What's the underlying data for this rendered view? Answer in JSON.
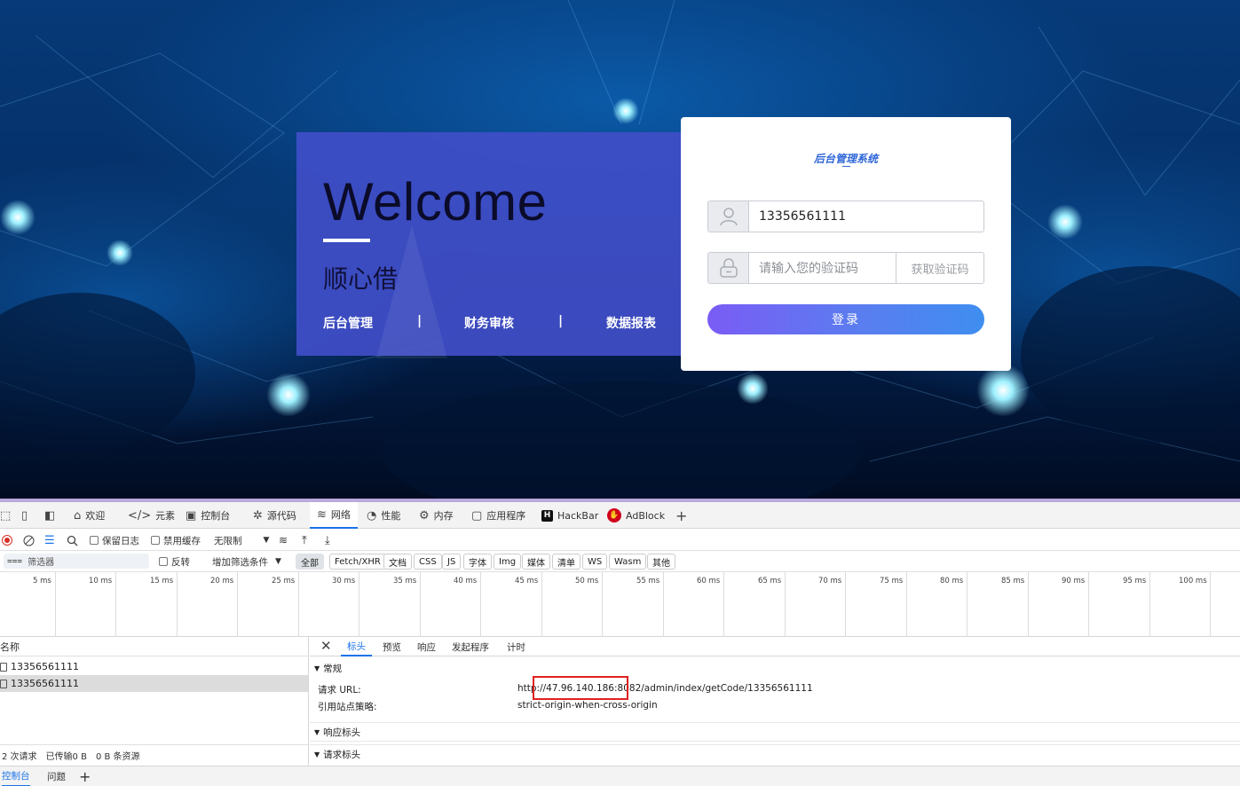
{
  "welcome": {
    "title": "Welcome",
    "subtitle": "顺心借",
    "nav": [
      "后台管理",
      "|",
      "财务审核",
      "|",
      "数据报表"
    ]
  },
  "login": {
    "title": "后台管理系统",
    "phone_value": "13356561111",
    "code_placeholder": "请输入您的验证码",
    "get_code_label": "获取验证码",
    "submit_label": "登录",
    "user_icon": "user-icon",
    "lock_icon": "lock-icon",
    "accent_color": "#5a7df0"
  },
  "devtools": {
    "tabs": [
      {
        "icon": "home-icon",
        "label": "欢迎"
      },
      {
        "icon": "code-icon",
        "label": "元素"
      },
      {
        "icon": "console-icon",
        "label": "控制台"
      },
      {
        "icon": "bug-icon",
        "label": "源代码"
      },
      {
        "icon": "wifi-icon",
        "label": "网络"
      },
      {
        "icon": "performance-icon",
        "label": "性能"
      },
      {
        "icon": "memory-icon",
        "label": "内存"
      },
      {
        "icon": "application-icon",
        "label": "应用程序"
      },
      {
        "icon": "hackbar-icon",
        "label": "HackBar"
      },
      {
        "icon": "adblock-icon",
        "label": "AdBlock"
      }
    ],
    "toolbar": {
      "preserve_log": "保留日志",
      "disable_cache": "禁用缓存",
      "throttle": "无限制"
    },
    "filter": {
      "placeholder": "筛选器",
      "invert": "反转",
      "more_filters": "增加筛选条件",
      "chips": [
        "全部",
        "Fetch/XHR",
        "文档",
        "CSS",
        "JS",
        "字体",
        "Img",
        "媒体",
        "清单",
        "WS",
        "Wasm",
        "其他"
      ]
    },
    "timeline_ticks": [
      "5 ms",
      "10 ms",
      "15 ms",
      "20 ms",
      "25 ms",
      "30 ms",
      "35 ms",
      "40 ms",
      "45 ms",
      "50 ms",
      "55 ms",
      "60 ms",
      "65 ms",
      "70 ms",
      "75 ms",
      "80 ms",
      "85 ms",
      "90 ms",
      "95 ms",
      "100 ms"
    ],
    "requests": {
      "header": "名称",
      "rows": [
        "13356561111",
        "13356561111"
      ],
      "status": [
        "2 次请求",
        "已传输0 B",
        "0 B 条资源"
      ]
    },
    "detail": {
      "tabs": [
        "标头",
        "预览",
        "响应",
        "发起程序",
        "计时"
      ],
      "general": "常规",
      "request_url_label": "请求 URL:",
      "request_url_value": "http://47.96.140.186:8082/admin/index/getCode/13356561111",
      "referrer_label": "引用站点策略:",
      "referrer_value": "strict-origin-when-cross-origin",
      "response_headers": "响应标头",
      "request_headers": "请求标头"
    },
    "bottom_tabs": [
      "控制台",
      "问题"
    ]
  }
}
